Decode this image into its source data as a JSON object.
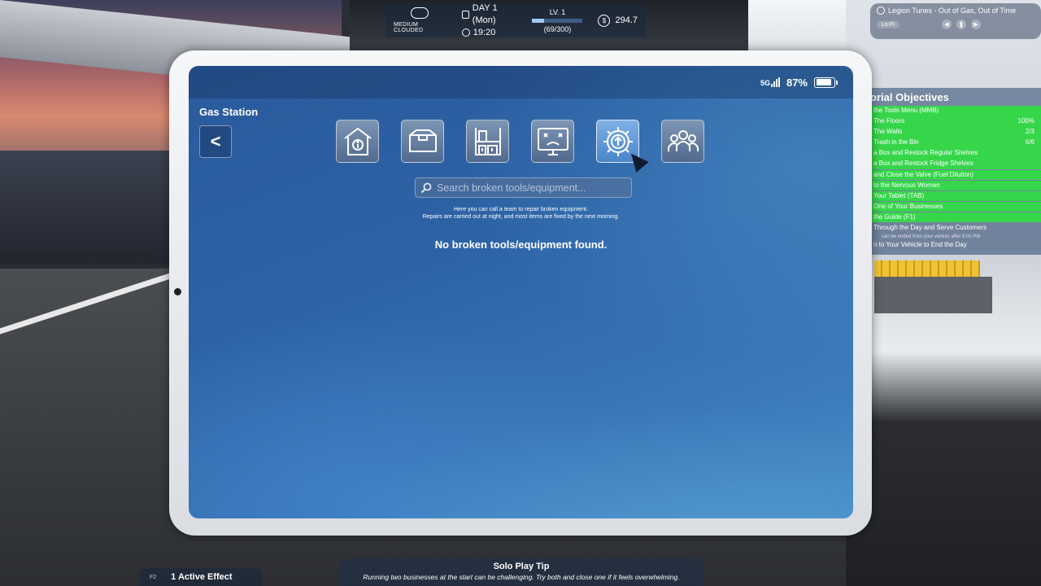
{
  "hud": {
    "weather": "MEDIUM CLOUDED",
    "day": "DAY 1 (Mon)",
    "time": "19:20",
    "level": "LV. 1",
    "xp": "(69/300)",
    "xp_fraction": 0.23,
    "money": "294.7",
    "money_symbol": "$"
  },
  "music": {
    "track": "Legion Tunes - Out of Gas, Out of Time",
    "genre": "Lo-Fi"
  },
  "objectives": {
    "title": "orial Objectives",
    "items": [
      {
        "label": "the Tools Menu (MMB)",
        "value": "",
        "done": true
      },
      {
        "label": "The Floors",
        "value": "100%",
        "done": true
      },
      {
        "label": "The Walls",
        "value": "2/3",
        "done": true
      },
      {
        "label": "Trash in the Bin",
        "value": "6/6",
        "done": true
      },
      {
        "label": "a Box and Restock Regular Shelves",
        "value": "",
        "done": true
      },
      {
        "label": "a Box and Restock Fridge Shelves",
        "value": "",
        "done": true
      },
      {
        "label": "and Close the Valve (Fuel Dilution)",
        "value": "",
        "done": true
      },
      {
        "label": "to the Nervous Woman",
        "value": "",
        "done": true
      },
      {
        "label": "Your Tablet (TAB)",
        "value": "",
        "done": true
      },
      {
        "label": "One of Your Businesses",
        "value": "",
        "done": true
      },
      {
        "label": "the Guide (F1)",
        "value": "",
        "done": true
      },
      {
        "label": "Through the Day and Serve Customers",
        "value": "",
        "done": false
      },
      {
        "label": "can be ended from your vehicle after 8:00 PM",
        "value": "",
        "done": false,
        "small": true
      },
      {
        "label": "n to Your Vehicle to End the Day",
        "value": "",
        "done": false
      }
    ]
  },
  "tablet": {
    "signal": "5G",
    "battery": "87%",
    "battery_fraction": 0.87,
    "app_name": "Gas Station",
    "back_symbol": "<",
    "tabs": [
      {
        "icon": "store-info-icon",
        "active": false
      },
      {
        "icon": "box-icon",
        "active": false
      },
      {
        "icon": "shelf-icon",
        "active": false
      },
      {
        "icon": "broken-monitor-icon",
        "active": false
      },
      {
        "icon": "gear-upgrade-icon",
        "active": true
      },
      {
        "icon": "staff-icon",
        "active": false
      }
    ],
    "search_placeholder": "Search broken tools/equipment...",
    "info_line1": "Here you can call a team to repair broken equipment.",
    "info_line2": "Repairs are carried out at night, and most items are fixed by the next morning.",
    "empty_message": "No broken tools/equipment found."
  },
  "bottom": {
    "effects_key": "F2",
    "effects_label": "1 Active Effect",
    "tip_title": "Solo Play Tip",
    "tip_body": "Running two businesses at the start can be challenging. Try both and close one if it feels overwhelming."
  },
  "colors": {
    "objective_done": "#36d64a",
    "screen_blue": "#2d63a6",
    "active_tab": "#4a86c8"
  }
}
